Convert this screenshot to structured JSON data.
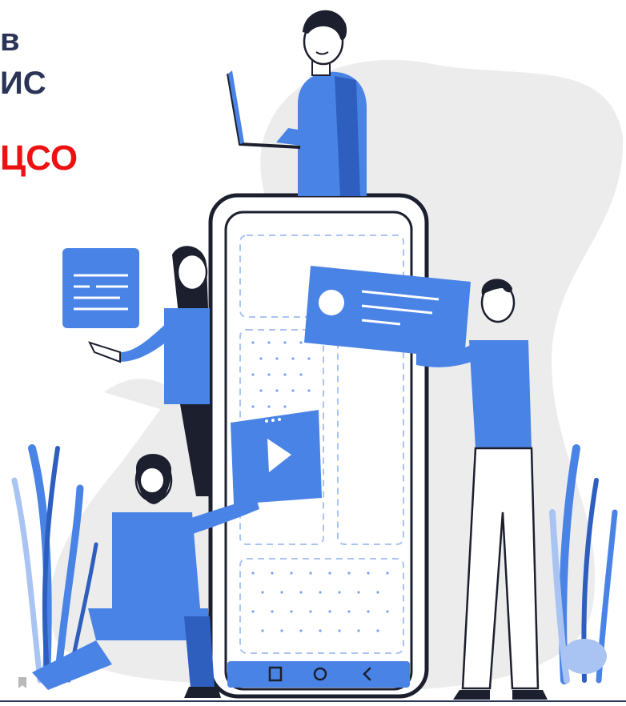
{
  "heading": {
    "line1": "в",
    "line2": "ИС",
    "line3": "ЦСО"
  },
  "colors": {
    "heading": "#2b3457",
    "accent_red": "#ee1111",
    "primary_blue": "#4a83e6",
    "dark_blue": "#2e5fbf",
    "light_blue": "#a9c4f2",
    "background_blob": "#ececec"
  },
  "phone": {
    "nav_icons": [
      "square-nav-icon",
      "circle-nav-icon",
      "back-nav-icon"
    ]
  }
}
